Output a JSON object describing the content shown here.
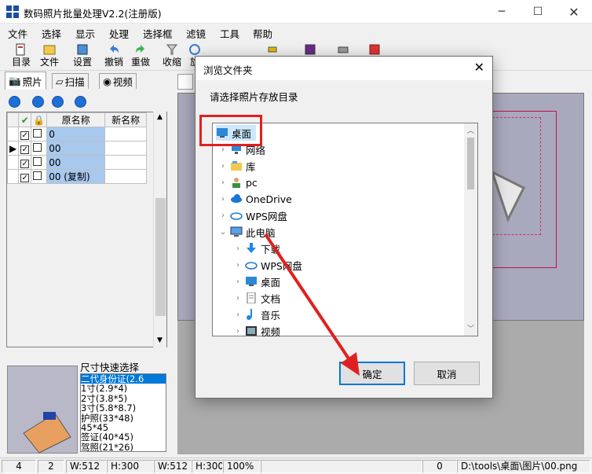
{
  "app": {
    "title": "数码照片批量处理V2.2(注册版)"
  },
  "menu": [
    "文件",
    "选择",
    "显示",
    "处理",
    "选择框",
    "滤镜",
    "工具",
    "帮助"
  ],
  "toolbar": [
    {
      "label": "目录"
    },
    {
      "label": "文件"
    },
    {
      "label": "设置"
    },
    {
      "label": "撤销"
    },
    {
      "label": "重做"
    },
    {
      "label": "收缩"
    },
    {
      "label": "旋"
    }
  ],
  "left_tabs": [
    "照片",
    "扫描",
    "视频"
  ],
  "grid": {
    "headers": [
      "原名称",
      "新名称"
    ],
    "rows": [
      {
        "name": "0",
        "new": ""
      },
      {
        "name": "00",
        "new": ""
      },
      {
        "name": "00",
        "new": ""
      },
      {
        "name": "00 (复制)",
        "new": ""
      }
    ]
  },
  "size_panel": {
    "title": "尺寸快速选择",
    "items": [
      "二代身份证(2.6",
      "1寸(2.9*4)",
      "2寸(3.8*5)",
      "3寸(5.8*8.7)",
      "护照(33*48)",
      "45*45",
      "签证(40*45)",
      "驾照(21*26)"
    ]
  },
  "dialog": {
    "title": "浏览文件夹",
    "prompt": "请选择照片存放目录",
    "tree": [
      {
        "label": "桌面",
        "level": 0,
        "arrow": "",
        "icon": "desktop-icon"
      },
      {
        "label": "网络",
        "level": 1,
        "arrow": "›",
        "icon": "network-icon"
      },
      {
        "label": "库",
        "level": 1,
        "arrow": "›",
        "icon": "library-icon"
      },
      {
        "label": "pc",
        "level": 1,
        "arrow": "›",
        "icon": "user-icon"
      },
      {
        "label": "OneDrive",
        "level": 1,
        "arrow": "›",
        "icon": "cloud-icon"
      },
      {
        "label": "WPS网盘",
        "level": 1,
        "arrow": "›",
        "icon": "wps-cloud-icon"
      },
      {
        "label": "此电脑",
        "level": 1,
        "arrow": "⌄",
        "icon": "computer-icon"
      },
      {
        "label": "下载",
        "level": 2,
        "arrow": "›",
        "icon": "download-icon"
      },
      {
        "label": "WPS网盘",
        "level": 2,
        "arrow": "›",
        "icon": "wps-cloud-icon"
      },
      {
        "label": "桌面",
        "level": 2,
        "arrow": "›",
        "icon": "desktop-icon"
      },
      {
        "label": "文档",
        "level": 2,
        "arrow": "›",
        "icon": "document-icon"
      },
      {
        "label": "音乐",
        "level": 2,
        "arrow": "›",
        "icon": "music-icon"
      },
      {
        "label": "视频",
        "level": 2,
        "arrow": "›",
        "icon": "video-icon"
      }
    ],
    "ok": "确定",
    "cancel": "取消"
  },
  "status": [
    "4",
    "2",
    "W:512",
    "H:300",
    "W:512",
    "H:300",
    "100%",
    "",
    "0",
    "D:\\tools\\桌面\\图片\\00.png"
  ],
  "colors": {
    "accent": "#0078d7",
    "highlight": "#e02020"
  }
}
